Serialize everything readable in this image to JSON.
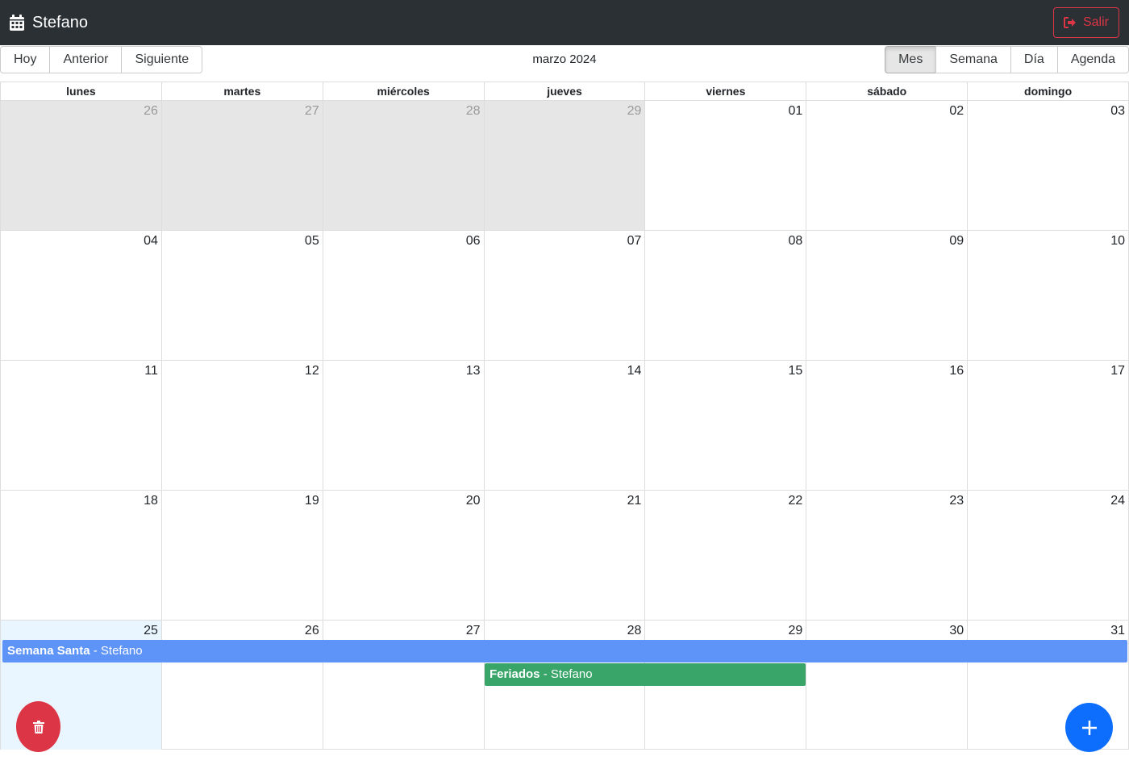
{
  "navbar": {
    "title": "Stefano",
    "brand_icon": "calendar-icon",
    "logout_label": "Salir",
    "logout_icon": "sign-out-icon"
  },
  "toolbar": {
    "today": "Hoy",
    "back": "Anterior",
    "next": "Siguiente",
    "label": "marzo 2024",
    "views": [
      "Mes",
      "Semana",
      "Día",
      "Agenda"
    ],
    "active_view": "Mes"
  },
  "calendar": {
    "weekdays": [
      "lunes",
      "martes",
      "miércoles",
      "jueves",
      "viernes",
      "sábado",
      "domingo"
    ],
    "weeks": [
      [
        "26",
        "27",
        "28",
        "29",
        "01",
        "02",
        "03"
      ],
      [
        "04",
        "05",
        "06",
        "07",
        "08",
        "09",
        "10"
      ],
      [
        "11",
        "12",
        "13",
        "14",
        "15",
        "16",
        "17"
      ],
      [
        "18",
        "19",
        "20",
        "21",
        "22",
        "23",
        "24"
      ],
      [
        "25",
        "26",
        "27",
        "28",
        "29",
        "30",
        "31"
      ]
    ],
    "events": [
      {
        "title": "Semana Santa",
        "separator": " - ",
        "user": "Stefano",
        "color": "#5e94f7"
      },
      {
        "title": "Feriados",
        "separator": " - ",
        "user": "Stefano",
        "color": "#3aa568"
      }
    ]
  },
  "colors": {
    "navbar_bg": "#2b3035",
    "danger": "#dc3545",
    "primary": "#0d6efd",
    "off_range_bg": "#e6e6e6",
    "today_bg": "#eaf6ff"
  },
  "fabs": {
    "delete_icon": "trash-icon",
    "add_icon": "plus-icon"
  }
}
